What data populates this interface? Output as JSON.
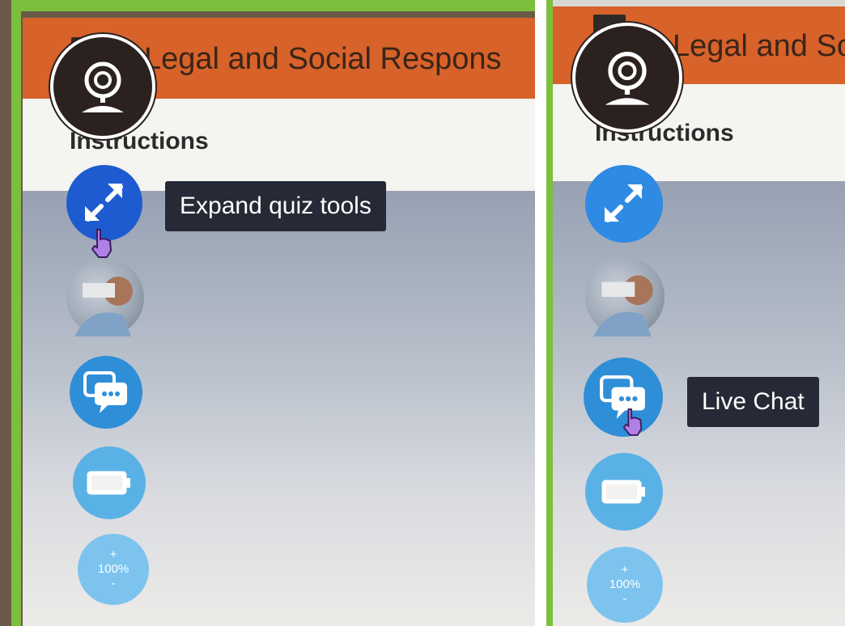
{
  "header": {
    "title": "Legal and Social Respons"
  },
  "section": {
    "heading": "Instructions"
  },
  "toolbar": {
    "expand_tooltip": "Expand quiz tools",
    "chat_tooltip": "Live Chat",
    "zoom_plus": "+",
    "zoom_level": "100%",
    "zoom_minus": "-"
  },
  "colors": {
    "header_orange": "#d7622a",
    "expand_blue": "#1e5bd0",
    "chat_blue": "#2f8ed8",
    "tooltip_bg": "#262a36"
  },
  "icons": [
    "webcam-icon",
    "expand-arrows-icon",
    "chat-bubbles-icon",
    "battery-icon",
    "hand-cursor-icon"
  ]
}
